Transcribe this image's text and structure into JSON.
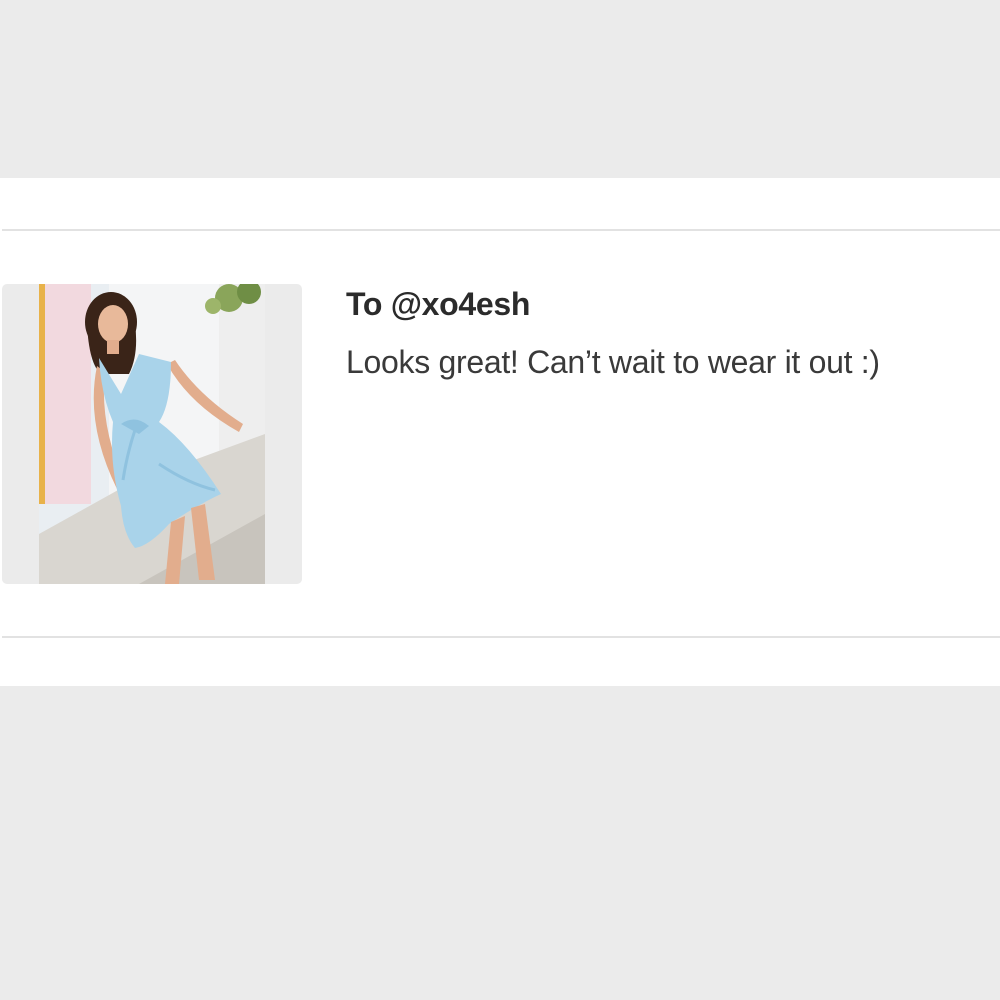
{
  "review": {
    "recipient": "To @xo4esh",
    "message": "Looks great! Can’t wait to wear it out :)",
    "photo_icon": "dress-photo"
  },
  "colors": {
    "page_bg": "#ebebeb",
    "card_bg": "#ffffff",
    "divider": "#e2e2e2",
    "dress": "#a9d3ea"
  }
}
